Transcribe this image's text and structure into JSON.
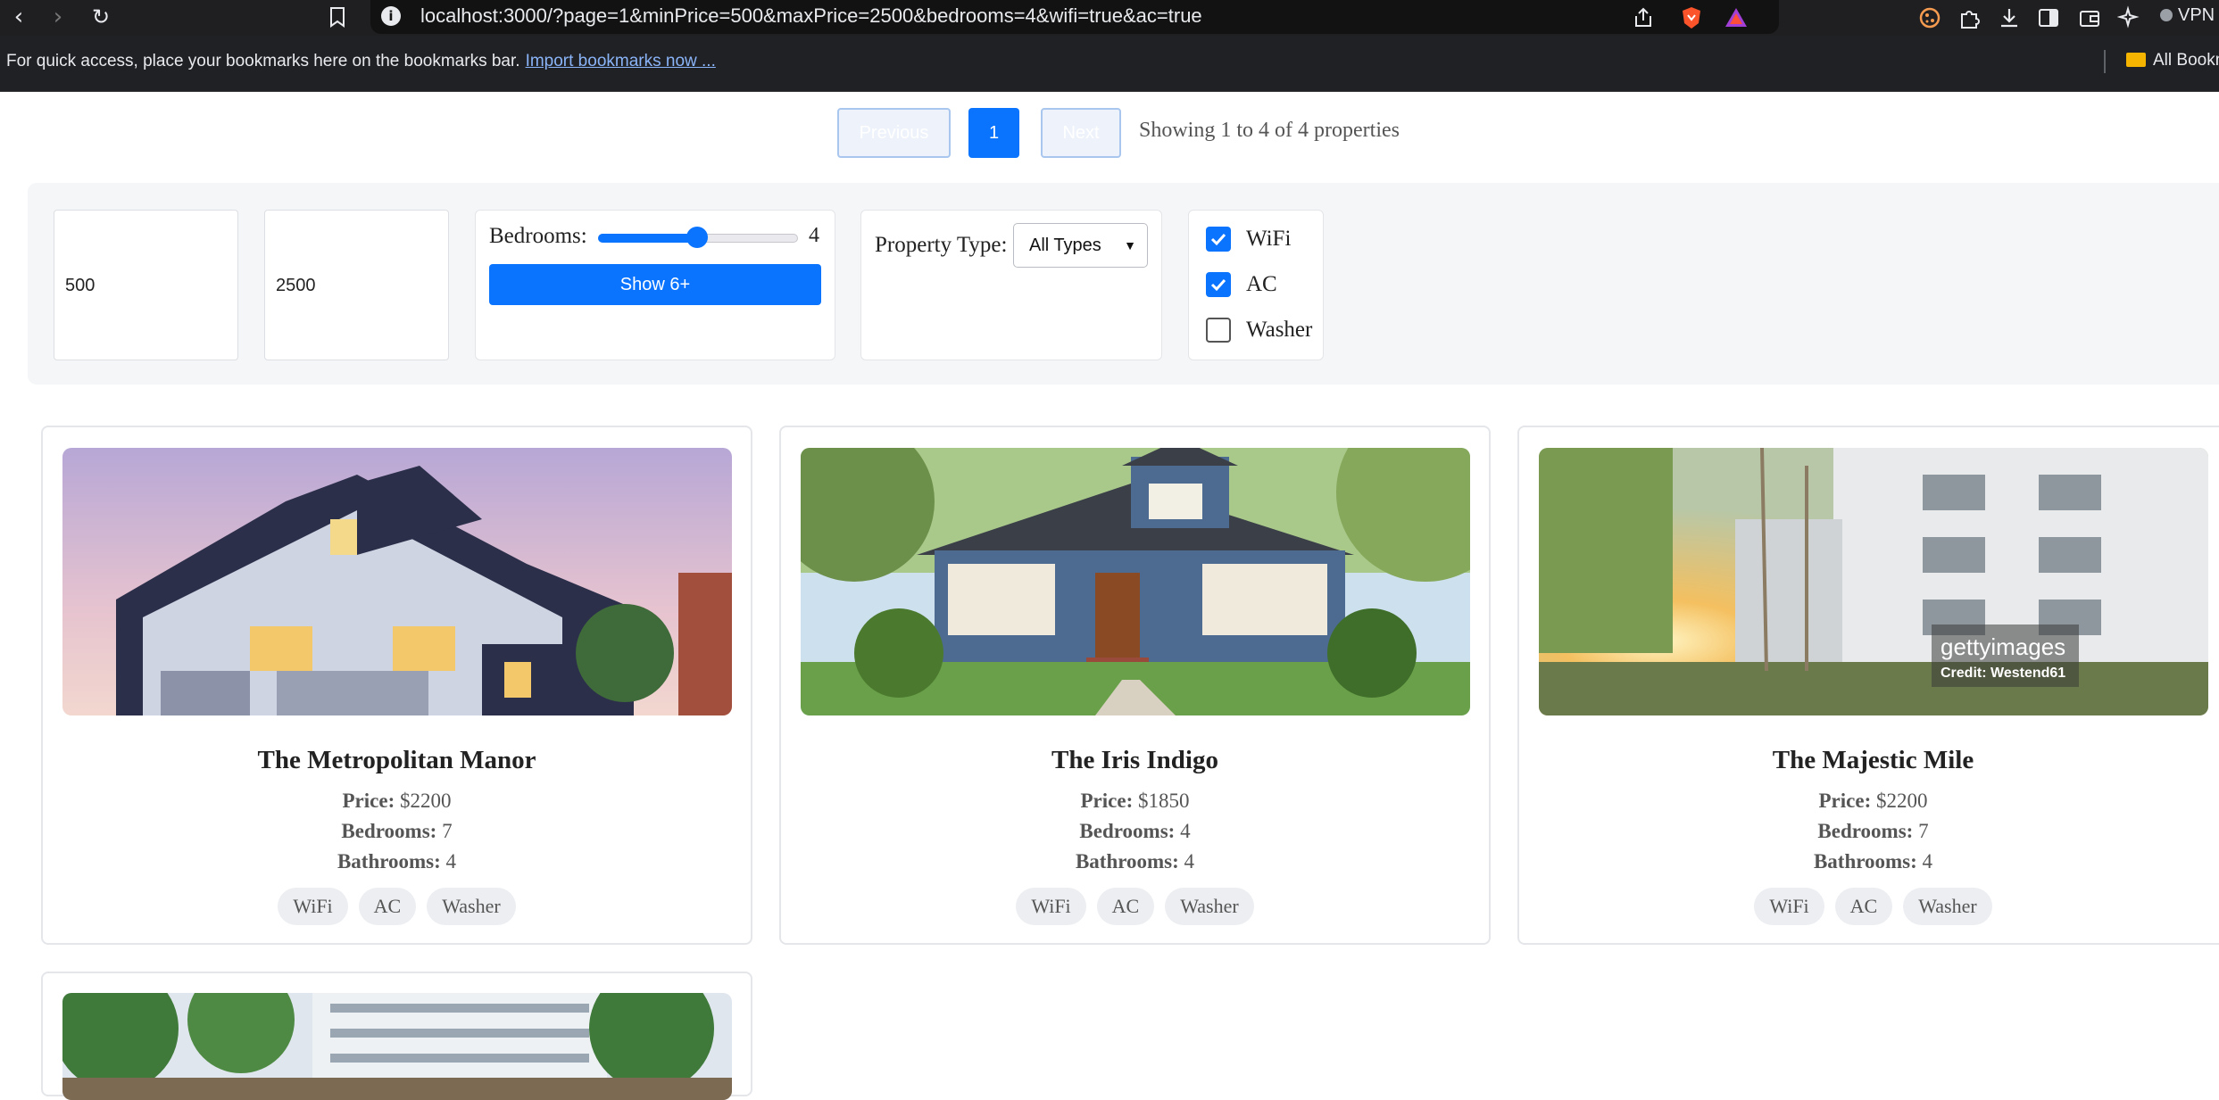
{
  "browser": {
    "url": "localhost:3000/?page=1&minPrice=500&maxPrice=2500&bedrooms=4&wifi=true&ac=true",
    "bookmarks_message": "For quick access, place your bookmarks here on the bookmarks bar.",
    "bookmarks_link": "Import bookmarks now ...",
    "all_bookmarks": "All Bookm",
    "vpn_label": "VPN"
  },
  "pagination": {
    "previous_label": "Previous",
    "current_page": "1",
    "next_label": "Next",
    "summary": "Showing 1 to 4 of 4 properties"
  },
  "filters": {
    "min_price": "500",
    "max_price": "2500",
    "bedrooms_label": "Bedrooms:",
    "bedrooms_value": "4",
    "bedrooms_slider_fraction": 0.5,
    "show_more_label": "Show 6+",
    "property_type_label": "Property Type:",
    "property_type_selected": "All Types",
    "amenities": [
      {
        "label": "WiFi",
        "checked": true
      },
      {
        "label": "AC",
        "checked": true
      },
      {
        "label": "Washer",
        "checked": false
      }
    ]
  },
  "properties": [
    {
      "name": "The Metropolitan Manor",
      "price_label": "Price:",
      "price": "$2200",
      "bedrooms_label": "Bedrooms:",
      "bedrooms": "7",
      "bathrooms_label": "Bathrooms:",
      "bathrooms": "4",
      "amenities": [
        "WiFi",
        "AC",
        "Washer"
      ]
    },
    {
      "name": "The Iris Indigo",
      "price_label": "Price:",
      "price": "$1850",
      "bedrooms_label": "Bedrooms:",
      "bedrooms": "4",
      "bathrooms_label": "Bathrooms:",
      "bathrooms": "4",
      "amenities": [
        "WiFi",
        "AC",
        "Washer"
      ]
    },
    {
      "name": "The Majestic Mile",
      "price_label": "Price:",
      "price": "$2200",
      "bedrooms_label": "Bedrooms:",
      "bedrooms": "7",
      "bathrooms_label": "Bathrooms:",
      "bathrooms": "4",
      "amenities": [
        "WiFi",
        "AC",
        "Washer"
      ],
      "image_watermark": "gettyimages",
      "image_credit": "Credit: Westend61"
    }
  ]
}
